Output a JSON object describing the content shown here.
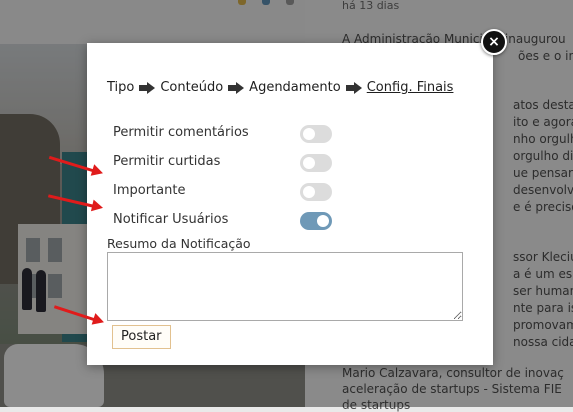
{
  "background": {
    "time_ago": "há 13 dias",
    "article_lines": [
      "A Administração Municipal inaugurou",
      "ões e o início",
      "",
      "atos destaca",
      "ito e agora",
      "nho orgulho",
      "orgulho disso",
      "ue pensar em",
      "desenvolve a",
      "e é preciso d",
      "",
      "ssor Klecius",
      "a é um espa",
      "ser humano",
      "nte para isso",
      "promovam e",
      "nossa cidad",
      "Mario Calzavara, consultor de inovaç",
      "aceleração de startups - Sistema FIE",
      "de startups"
    ]
  },
  "modal": {
    "close_label": "×",
    "steps": [
      {
        "label": "Tipo"
      },
      {
        "label": "Conteúdo"
      },
      {
        "label": "Agendamento"
      },
      {
        "label": "Config. Finais"
      }
    ],
    "options": [
      {
        "label": "Permitir comentários",
        "enabled": false
      },
      {
        "label": "Permitir curtidas",
        "enabled": false
      },
      {
        "label": "Importante",
        "enabled": false
      },
      {
        "label": "Notificar Usuários",
        "enabled": true
      }
    ],
    "summary_label": "Resumo da Notificação",
    "summary_value": "",
    "post_label": "Postar"
  },
  "colors": {
    "toggle_on": "#6f99b7",
    "toggle_off": "#dcdcdc",
    "annotation": "#e01b1b"
  }
}
